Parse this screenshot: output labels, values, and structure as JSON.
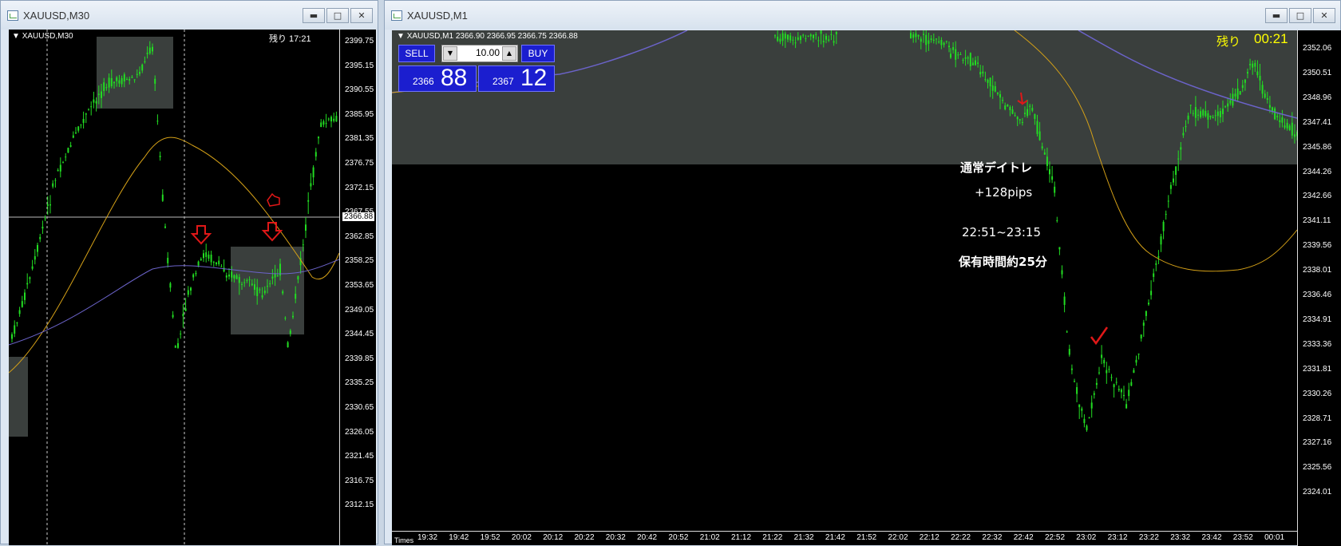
{
  "left_window": {
    "title": "XAUUSD,M30",
    "chart_label": "XAUUSD,M30",
    "remaining": "残り 17:21",
    "current_price": "2366.88",
    "price_ticks": [
      "2399.75",
      "2395.15",
      "2390.55",
      "2385.95",
      "2381.35",
      "2376.75",
      "2372.15",
      "2367.55",
      "2362.85",
      "2358.25",
      "2353.65",
      "2349.05",
      "2344.45",
      "2339.85",
      "2335.25",
      "2330.65",
      "2326.05",
      "2321.45",
      "2316.75",
      "2312.15"
    ]
  },
  "right_window": {
    "title": "XAUUSD,M1",
    "chart_label": "XAUUSD,M1",
    "ohlc": "2366.90 2366.95 2366.75 2366.88",
    "remaining_label": "残り",
    "remaining_time": "00:21",
    "price_ticks": [
      "2352.06",
      "2350.51",
      "2348.96",
      "2347.41",
      "2345.86",
      "2344.26",
      "2342.66",
      "2341.11",
      "2339.56",
      "2338.01",
      "2336.46",
      "2334.91",
      "2333.36",
      "2331.81",
      "2330.26",
      "2328.71",
      "2327.16",
      "2325.56",
      "2324.01"
    ],
    "time_ticks": [
      "19:32",
      "19:42",
      "19:52",
      "20:02",
      "20:12",
      "20:22",
      "20:32",
      "20:42",
      "20:52",
      "21:02",
      "21:12",
      "21:22",
      "21:32",
      "21:42",
      "21:52",
      "22:02",
      "22:12",
      "22:22",
      "22:32",
      "22:42",
      "22:52",
      "23:02",
      "23:12",
      "23:22",
      "23:32",
      "23:42",
      "23:52",
      "00:01"
    ],
    "time_label": "Times",
    "trade_panel": {
      "sell_label": "SELL",
      "buy_label": "BUY",
      "lot": "10.00",
      "sell_small": "2366",
      "sell_big": "88",
      "buy_small": "2367",
      "buy_big": "12"
    },
    "notes": {
      "style": "通常デイトレ",
      "pips": "+128pips",
      "time_range": "22:51~23:15",
      "holding": "保有時間約25分"
    }
  },
  "window_buttons": {
    "minimize": "▬",
    "maximize": "□",
    "close": "✕"
  },
  "colors": {
    "candle": "#22dd22",
    "ma_fast": "#d4a017",
    "ma_slow": "#6b63c9",
    "zone": "#3a3f3d",
    "arrow": "#e01818",
    "panel_blue": "#1b1ecf"
  }
}
